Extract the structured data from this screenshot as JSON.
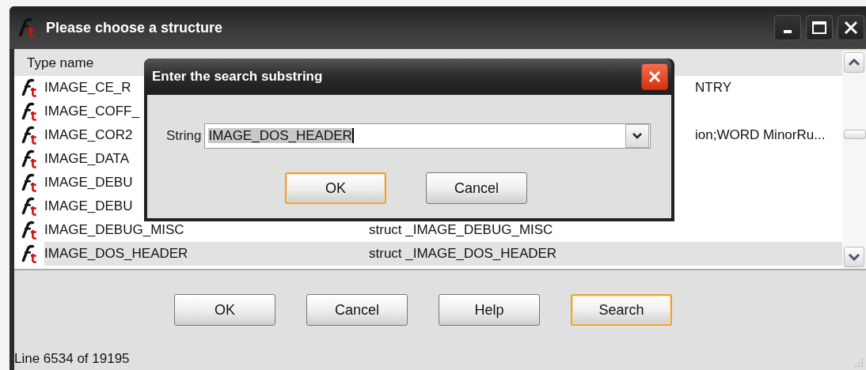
{
  "window": {
    "title": "Please choose a structure"
  },
  "table": {
    "columns": [
      "Type name"
    ],
    "rows": [
      {
        "name": "IMAGE_CE_R",
        "declaration": "NTRY",
        "kind": "covered",
        "selected": false
      },
      {
        "name": "IMAGE_COFF_",
        "selected": false
      },
      {
        "name": "IMAGE_COR2",
        "declaration": "ion;WORD MinorRu...",
        "kind": "covered",
        "selected": false
      },
      {
        "name": "IMAGE_DATA",
        "selected": false
      },
      {
        "name": "IMAGE_DEBU",
        "selected": false
      },
      {
        "name": "IMAGE_DEBU",
        "selected": false
      },
      {
        "name": "IMAGE_DEBUG_MISC",
        "declaration": "struct _IMAGE_DEBUG_MISC",
        "kind": "full",
        "selected": false
      },
      {
        "name": "IMAGE_DOS_HEADER",
        "declaration": "struct _IMAGE_DOS_HEADER",
        "kind": "full",
        "selected": true
      }
    ]
  },
  "buttons": [
    {
      "label": "OK",
      "focused": false
    },
    {
      "label": "Cancel",
      "focused": false
    },
    {
      "label": "Help",
      "focused": false
    },
    {
      "label": "Search",
      "focused": true
    }
  ],
  "status_bar": "Line 6534 of 19195",
  "dialog": {
    "title": "Enter the search substring",
    "field_label": "String",
    "value": "IMAGE_DOS_HEADER",
    "buttons": [
      {
        "label": "OK",
        "focused": true
      },
      {
        "label": "Cancel",
        "focused": false
      }
    ]
  }
}
